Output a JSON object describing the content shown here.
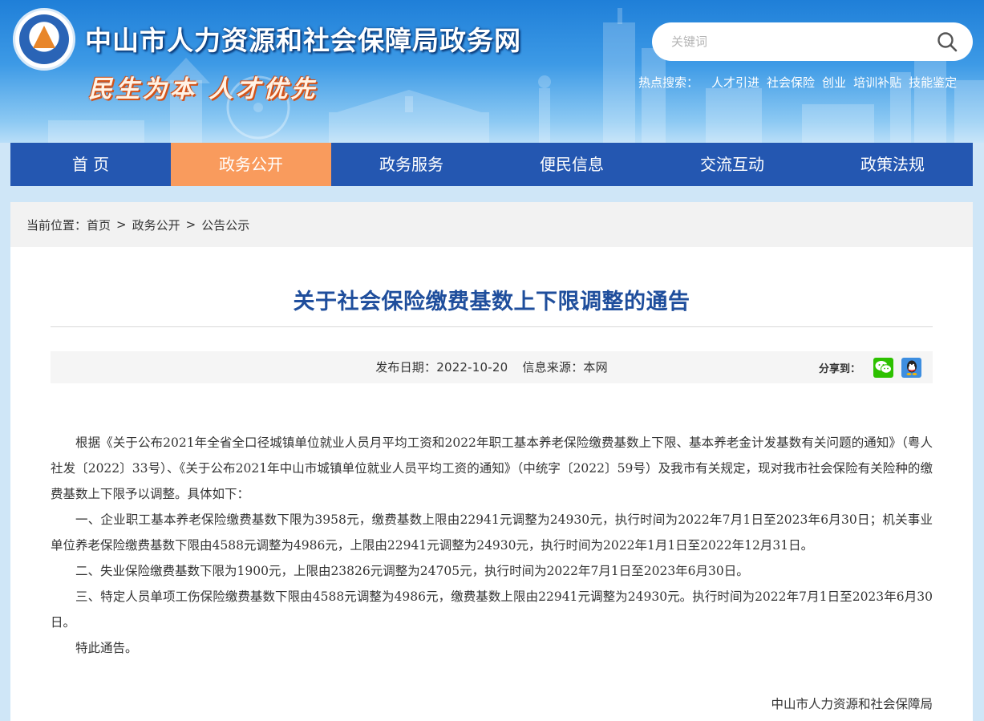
{
  "header": {
    "site_title": "中山市人力资源和社会保障局政务网",
    "slogan": "民生为本 人才优先",
    "search": {
      "placeholder": "关键词"
    },
    "hot_search": {
      "label": "热点搜索：",
      "links": [
        "人才引进",
        "社会保险",
        "创业",
        "培训补贴",
        "技能鉴定"
      ]
    }
  },
  "nav": {
    "items": [
      "首 页",
      "政务公开",
      "政务服务",
      "便民信息",
      "交流互动",
      "政策法规"
    ],
    "active_index": 1
  },
  "breadcrumb": {
    "label": "当前位置：",
    "items": [
      "首页",
      "政务公开",
      "公告公示"
    ],
    "separator": ">"
  },
  "article": {
    "title": "关于社会保险缴费基数上下限调整的通告",
    "publish_date": "发布日期：2022-10-20",
    "source": "信息来源：本网",
    "share_label": "分享到：",
    "paragraphs": [
      "根据《关于公布2021年全省全口径城镇单位就业人员月平均工资和2022年职工基本养老保险缴费基数上下限、基本养老金计发基数有关问题的通知》（粤人社发〔2022〕33号）、《关于公布2021年中山市城镇单位就业人员平均工资的通知》（中统字〔2022〕59号）及我市有关规定，现对我市社会保险有关险种的缴费基数上下限予以调整。具体如下：",
      "一、企业职工基本养老保险缴费基数下限为3958元，缴费基数上限由22941元调整为24930元，执行时间为2022年7月1日至2023年6月30日；机关事业单位养老保险缴费基数下限由4588元调整为4986元，上限由22941元调整为24930元，执行时间为2022年1月1日至2022年12月31日。",
      "二、失业保险缴费基数下限为1900元，上限由23826元调整为24705元，执行时间为2022年7月1日至2023年6月30日。",
      "三、特定人员单项工伤保险缴费基数下限由4588元调整为4986元，缴费基数上限由22941元调整为24930元。执行时间为2022年7月1日至2023年6月30日。",
      "特此通告。"
    ],
    "signature": "中山市人力资源和社会保障局"
  },
  "colors": {
    "nav_bg": "#2457b1",
    "nav_active": "#f99b5d",
    "title": "#1f4e9c",
    "wechat": "#2dc100",
    "qq": "#3d8ee0"
  },
  "icons": {
    "search": "search-icon",
    "wechat": "wechat-icon",
    "qq": "qq-icon"
  }
}
